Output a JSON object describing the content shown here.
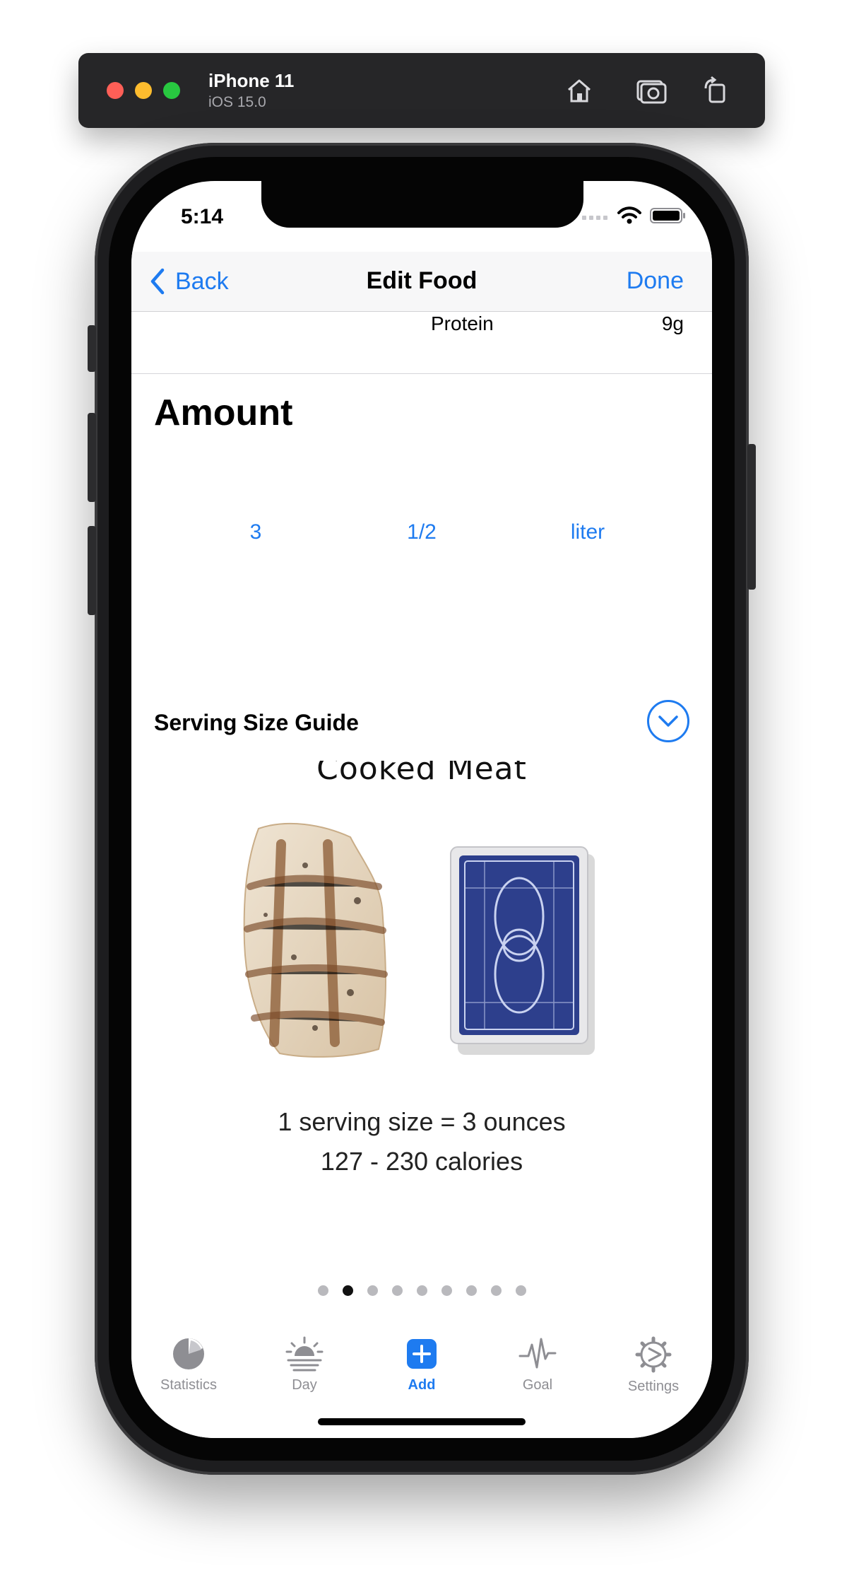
{
  "simulator": {
    "device_name": "iPhone 11",
    "os_version": "iOS 15.0",
    "buttons": [
      "home-icon",
      "screenshot-icon",
      "rotate-icon"
    ]
  },
  "status_bar": {
    "time": "5:14"
  },
  "navbar": {
    "back_label": "Back",
    "title": "Edit Food",
    "done_label": "Done"
  },
  "nutrition_row": {
    "label": "Protein",
    "value": "9g"
  },
  "amount": {
    "title": "Amount",
    "picker": {
      "whole": "3",
      "fraction": "1/2",
      "unit": "liter"
    }
  },
  "serving_guide": {
    "title": "Serving Size Guide",
    "card": {
      "title": "Cooked Meat",
      "line1": "1 serving size = 3 ounces",
      "line2": "127 - 230 calories"
    },
    "page_count": 9,
    "active_page_fraction": 0.2222
  },
  "tabbar": {
    "items": [
      {
        "label": "Statistics",
        "icon": "pie-chart-icon",
        "active": false
      },
      {
        "label": "Day",
        "icon": "sunrise-icon",
        "active": false
      },
      {
        "label": "Add",
        "icon": "plus-square-icon",
        "active": true
      },
      {
        "label": "Goal",
        "icon": "heartbeat-icon",
        "active": false
      },
      {
        "label": "Settings",
        "icon": "gear-icon",
        "active": false
      }
    ]
  },
  "colors": {
    "accent": "#1e7bf0",
    "inactive_tab": "#8e8e93",
    "card_back": "#2d3f8c"
  }
}
